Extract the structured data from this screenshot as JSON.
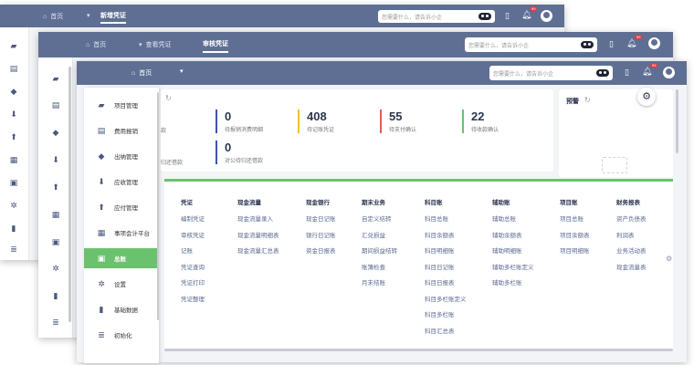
{
  "win1": {
    "home": "首页",
    "tab": "新增凭证",
    "search_placeholder": "您需要什么，请告诉小企",
    "badge": "99"
  },
  "win2": {
    "home": "首页",
    "tab1": "查看凭证",
    "tab2": "审核凭证",
    "search_placeholder": "您需要什么，请告诉小企",
    "badge": "99"
  },
  "win3": {
    "home": "首页",
    "search_placeholder": "您需要什么，请告诉小企",
    "badge": "99"
  },
  "menu": [
    {
      "label": "项目管理",
      "icon": "folder-icon"
    },
    {
      "label": "费用报销",
      "icon": "receipt-icon"
    },
    {
      "label": "出纳管理",
      "icon": "cashier-icon"
    },
    {
      "label": "应收管理",
      "icon": "receivable-icon"
    },
    {
      "label": "应付管理",
      "icon": "payable-icon"
    },
    {
      "label": "事项会计平台",
      "icon": "platform-icon"
    },
    {
      "label": "总账",
      "icon": "ledger-icon"
    },
    {
      "label": "设置",
      "icon": "settings-icon"
    },
    {
      "label": "基础数据",
      "icon": "chart-icon"
    },
    {
      "label": "初始化",
      "icon": "init-icon"
    }
  ],
  "stats": [
    {
      "num": "0",
      "label": "待报销消费明细",
      "color": "#3a55b0"
    },
    {
      "num": "408",
      "label": "待记账凭证",
      "color": "#f1c232"
    },
    {
      "num": "55",
      "label": "待支付确认",
      "color": "#e06155"
    },
    {
      "num": "22",
      "label": "待收款确认",
      "color": "#6bc26e"
    },
    {
      "num": "0",
      "label": "对公待归还借款",
      "color": "#3a55b0"
    }
  ],
  "partial_labels": {
    "left_top": "款",
    "left_bottom": "归还借款"
  },
  "warning": "预警",
  "columns": [
    {
      "title": "凭证",
      "items": [
        "编制凭证",
        "审核凭证",
        "记账",
        "凭证查询",
        "凭证打印",
        "凭证整理"
      ]
    },
    {
      "title": "现金流量",
      "items": [
        "现金流量录入",
        "现金流量明细表",
        "现金流量汇总表"
      ]
    },
    {
      "title": "现金银行",
      "items": [
        "现金日记账",
        "银行日记账",
        "资金日报表"
      ]
    },
    {
      "title": "期末业务",
      "items": [
        "自定义结转",
        "汇兑损益",
        "期间损益结转",
        "账簿检查",
        "月末结账"
      ]
    },
    {
      "title": "科目账",
      "items": [
        "科目总账",
        "科目余额表",
        "科目明细账",
        "科目日记账",
        "科目日报表",
        "科目多栏账定义",
        "科目多栏账",
        "科目汇总表"
      ]
    },
    {
      "title": "辅助账",
      "items": [
        "辅助总账",
        "辅助余额表",
        "辅助明细账",
        "辅助多栏账定义",
        "辅助多栏账"
      ]
    },
    {
      "title": "项目账",
      "items": [
        "项目总账",
        "项目余额表",
        "项目明细账"
      ]
    },
    {
      "title": "财务报表",
      "items": [
        "资产负债表",
        "利润表",
        "业务活动表",
        "现金流量表"
      ]
    }
  ]
}
